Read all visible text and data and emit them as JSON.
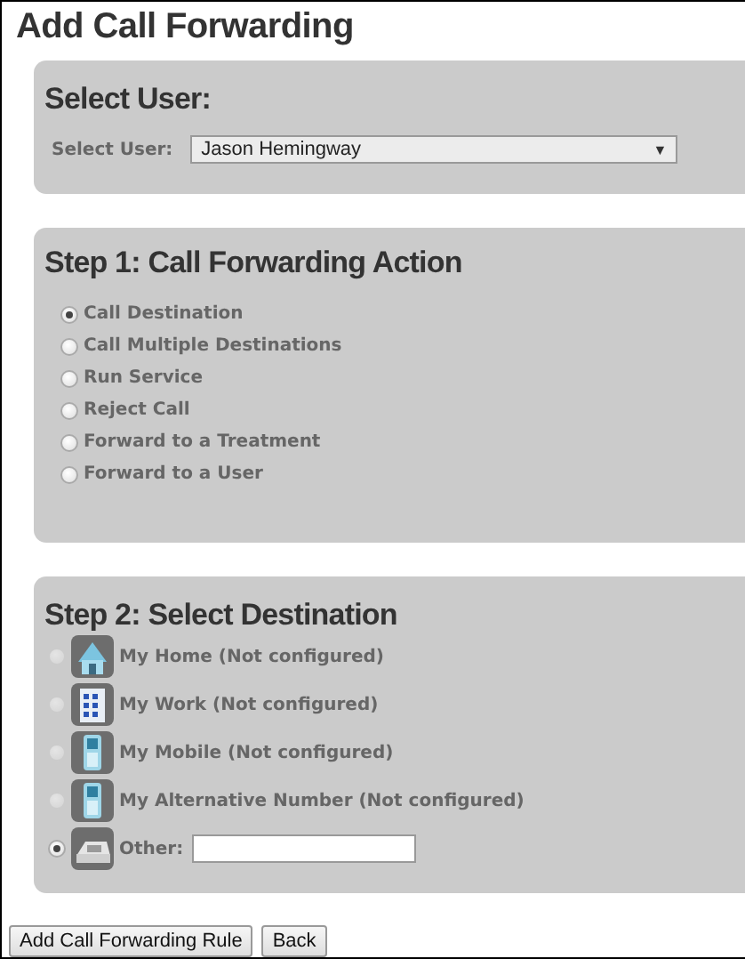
{
  "title": "Add Call Forwarding",
  "user_panel": {
    "heading": "Select User:",
    "label": "Select User:",
    "value": "Jason Hemingway",
    "caret": "▼"
  },
  "action_panel": {
    "heading": "Step 1: Call Forwarding Action",
    "options": [
      {
        "label": "Call Destination",
        "selected": true
      },
      {
        "label": "Call Multiple Destinations",
        "selected": false
      },
      {
        "label": "Run Service",
        "selected": false
      },
      {
        "label": "Reject Call",
        "selected": false
      },
      {
        "label": "Forward to a Treatment",
        "selected": false
      },
      {
        "label": "Forward to a User",
        "selected": false
      }
    ]
  },
  "destination_panel": {
    "heading": "Step 2: Select Destination",
    "options": [
      {
        "kind": "home",
        "label": "My Home (Not configured)",
        "selected": false,
        "disabled": true
      },
      {
        "kind": "work",
        "label": "My Work (Not configured)",
        "selected": false,
        "disabled": true
      },
      {
        "kind": "mobile",
        "label": "My Mobile (Not configured)",
        "selected": false,
        "disabled": true
      },
      {
        "kind": "mobile",
        "label": "My Alternative Number (Not configured)",
        "selected": false,
        "disabled": true
      },
      {
        "kind": "other",
        "label": "Other:",
        "selected": true,
        "disabled": false
      }
    ]
  },
  "buttons": [
    "Add Call Forwarding Rule",
    "Back"
  ]
}
